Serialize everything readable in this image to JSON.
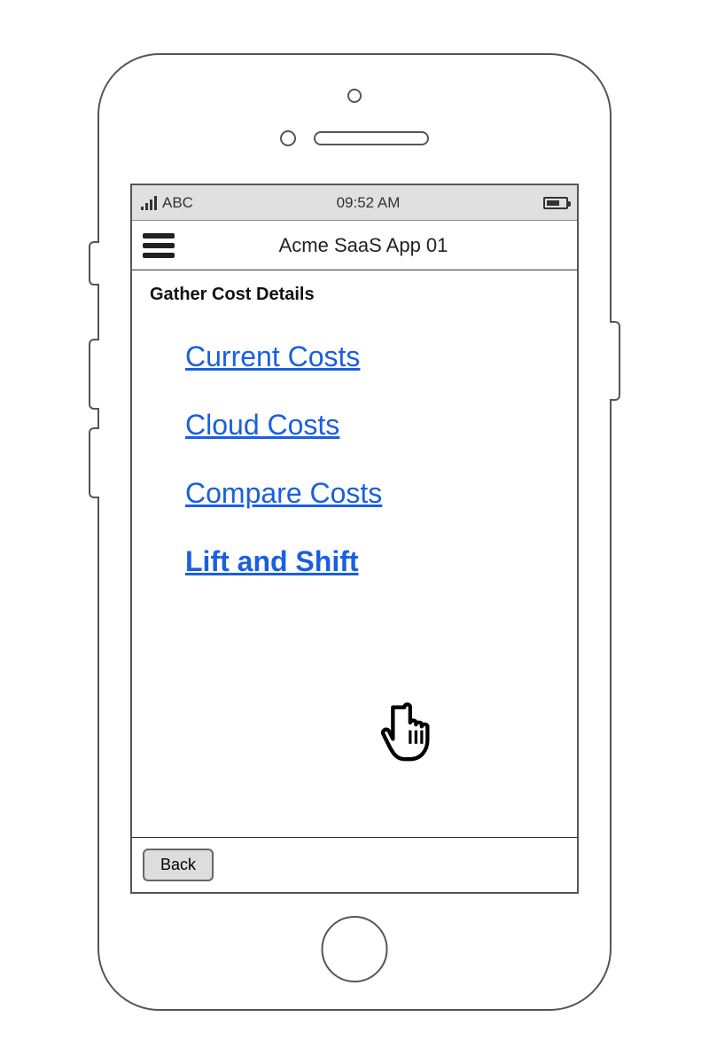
{
  "status_bar": {
    "carrier": "ABC",
    "time": "09:52 AM"
  },
  "nav": {
    "title": "Acme SaaS App 01"
  },
  "content": {
    "section_title": "Gather Cost Details",
    "links": [
      {
        "label": "Current Costs"
      },
      {
        "label": "Cloud Costs"
      },
      {
        "label": "Compare Costs"
      },
      {
        "label": "Lift and Shift"
      }
    ]
  },
  "footer": {
    "back_label": "Back"
  }
}
